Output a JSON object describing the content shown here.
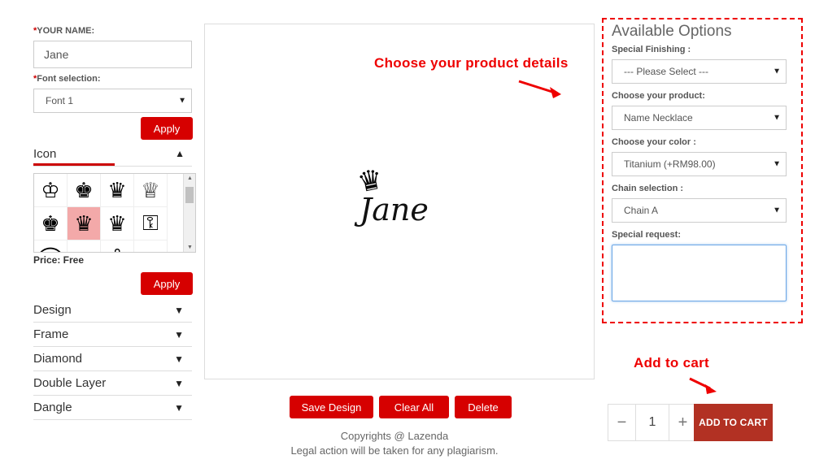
{
  "left": {
    "name_label_req": "*",
    "name_label": "YOUR NAME:",
    "name_value": "Jane",
    "font_label_req": "*",
    "font_label": "Font selection:",
    "font_value": "Font 1",
    "apply_label": "Apply",
    "icon_section": "Icon",
    "icons": [
      "♔",
      "♚",
      "♛",
      "♕",
      "♚",
      "♛",
      "♛",
      "⚿",
      "⌒",
      "❧",
      "⚓",
      "☙"
    ],
    "price": "Price: Free",
    "accordion": [
      "Design",
      "Frame",
      "Diamond",
      "Double Layer",
      "Dangle"
    ]
  },
  "canvas": {
    "callout_details": "Choose your product details",
    "preview_name": "Jane",
    "preview_crown": "♛",
    "callout_cart": "Add to cart"
  },
  "buttons": {
    "save": "Save Design",
    "clear": "Clear All",
    "delete": "Delete"
  },
  "footer": {
    "copyright": "Copyrights @ Lazenda",
    "legal": "Legal action will be taken for any plagiarism."
  },
  "options": {
    "title": "Available Options",
    "finishing_label": "Special Finishing :",
    "finishing_value": "--- Please Select ---",
    "product_label": "Choose your product:",
    "product_value": "Name Necklace",
    "color_label": "Choose your color :",
    "color_value": "Titanium (+RM98.00)",
    "chain_label": "Chain selection :",
    "chain_value": "Chain A",
    "request_label": "Special request:"
  },
  "cart": {
    "minus": "−",
    "qty": "1",
    "plus": "+",
    "add_label": "ADD TO CART"
  },
  "colors": {
    "accent": "#d60000",
    "cart": "#b23123",
    "callout": "#e00000"
  }
}
